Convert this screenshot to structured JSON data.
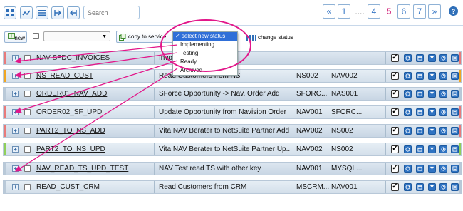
{
  "toolbar": {
    "icons": [
      "grid-icon",
      "shuffle-icon",
      "columns-icon",
      "import-icon",
      "export-icon"
    ],
    "search_placeholder": "Search"
  },
  "pagination": {
    "first": "«",
    "p1": "1",
    "ellipsis": "....",
    "p4": "4",
    "current": "5",
    "p6": "6",
    "p7": "7",
    "last": "»"
  },
  "help": "?",
  "actions": {
    "new_label": "new",
    "select_value": ".",
    "copy_label": "copy to service",
    "change_status_label": "change status"
  },
  "status_dropdown": {
    "options": [
      "✓ select new status",
      "Implementing",
      "Testing",
      "Ready",
      "Archived"
    ]
  },
  "rows": [
    {
      "name": "NAV-SFDC_INVOICES",
      "desc": "Invo",
      "src": "",
      "tgt": "",
      "left_color": "#e87a7a",
      "right_color": "#e87a7a",
      "alt": false
    },
    {
      "name": "NS_READ_CUST",
      "desc": "Read Customers from NS",
      "src": "NS002",
      "tgt": "NAV002",
      "left_color": "#f0a623",
      "right_color": "#f0a623",
      "alt": true
    },
    {
      "name": "ORDER01_NAV_ADD",
      "desc": "SForce Opportunity -> Nav. Order Add",
      "src": "SFORC...",
      "tgt": "NAS001",
      "left_color": "#b9c9d8",
      "right_color": "#b9c9d8",
      "alt": false
    },
    {
      "name": "ORDER02_SF_UPD",
      "desc": "Update Opportunity from Navision Order",
      "src": "NAV001",
      "tgt": "SFORC...",
      "left_color": "#e87a7a",
      "right_color": "#e87a7a",
      "alt": true
    },
    {
      "name": "PART2_TO_NS_ADD",
      "desc": "Vita NAV Berater to NetSuite Partner Add",
      "src": "NAV002",
      "tgt": "NS002",
      "left_color": "#e87a7a",
      "right_color": "#e87a7a",
      "alt": false
    },
    {
      "name": "PART2_TO_NS_UPD",
      "desc": "Vita NAV Berater to NetSuite Partner Up...",
      "src": "NAV002",
      "tgt": "NS002",
      "left_color": "#8fcf5a",
      "right_color": "#8fcf5a",
      "alt": true
    },
    {
      "name": "NAV_READ_TS_UPD_TEST",
      "desc": "NAV Test read TS with other key",
      "src": "NAV001",
      "tgt": "MYSQL...",
      "left_color": "#b9c9d8",
      "right_color": "#b9c9d8",
      "alt": false
    },
    {
      "name": "READ_CUST_CRM",
      "desc": "Read Customers from CRM",
      "src": "MSCRM...",
      "tgt": "NAV001",
      "left_color": "#b9c9d8",
      "right_color": "#b9c9d8",
      "alt": true
    }
  ],
  "row_icons": [
    "check-icon",
    "refresh-icon",
    "calendar-icon",
    "filter-icon",
    "clock-icon",
    "log-icon"
  ],
  "colors": {
    "accent": "#2f6fb8",
    "highlight": "#e2178a",
    "current_page": "#d2297e"
  }
}
